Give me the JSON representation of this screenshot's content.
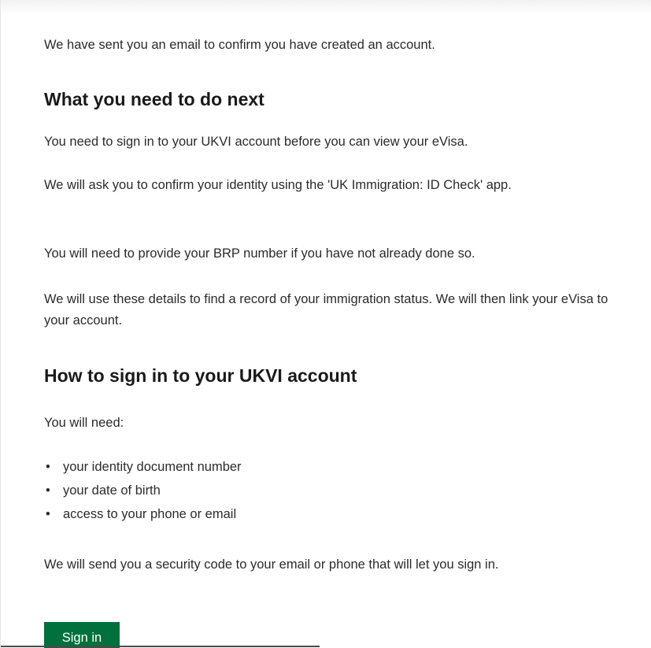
{
  "content": {
    "confirmation": "We have sent you an email to confirm you have created an account.",
    "next_heading": "What you need to do next",
    "next_paragraphs": [
      "You need to sign in to your UKVI account before you can view your eVisa.",
      "We will ask you to confirm your identity using the 'UK Immigration: ID Check' app.",
      "You will need to provide your BRP number if you have not already done so.",
      "We will use these details to find a record of your immigration status. We will then link your eVisa to your account."
    ],
    "signin_heading": "How to sign in to your UKVI account",
    "need_intro": "You will need:",
    "need_items": [
      "your identity document number",
      "your date of birth",
      "access to your phone or email"
    ],
    "security_code": "We will send you a security code to your email or phone that will let you sign in.",
    "signin_button": "Sign in"
  },
  "colors": {
    "button": "#00703c",
    "text": "#2b2b2b"
  }
}
